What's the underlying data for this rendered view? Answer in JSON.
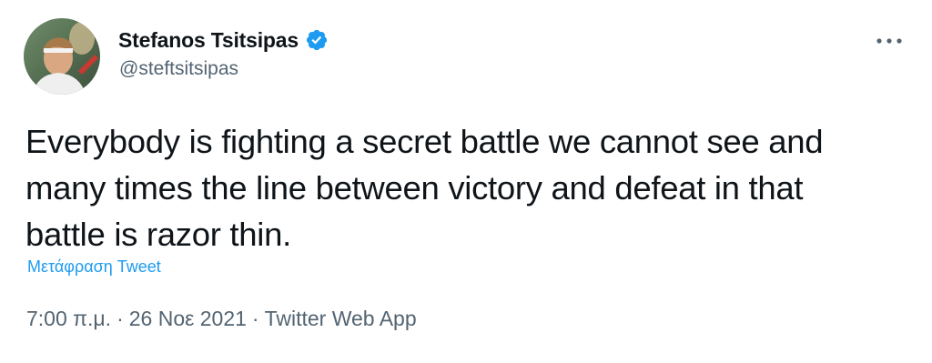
{
  "author": {
    "display_name": "Stefanos Tsitsipas",
    "handle": "@steftsitsipas",
    "verified": true
  },
  "tweet": {
    "text": "Everybody is fighting a secret battle we cannot see and\nmany times the line between victory and defeat in that\nbattle is razor thin.",
    "translate_label": "Μετάφραση Tweet",
    "time": "7:00 π.μ.",
    "date": "26 Νοε 2021",
    "source": "Twitter Web App",
    "separator": "·"
  },
  "icons": {
    "verified": "verified-badge-icon",
    "more": "more-horizontal-icon"
  },
  "colors": {
    "text_primary": "#0f1419",
    "text_secondary": "#536471",
    "link": "#1d9bf0",
    "verified_badge": "#1d9bf0"
  }
}
